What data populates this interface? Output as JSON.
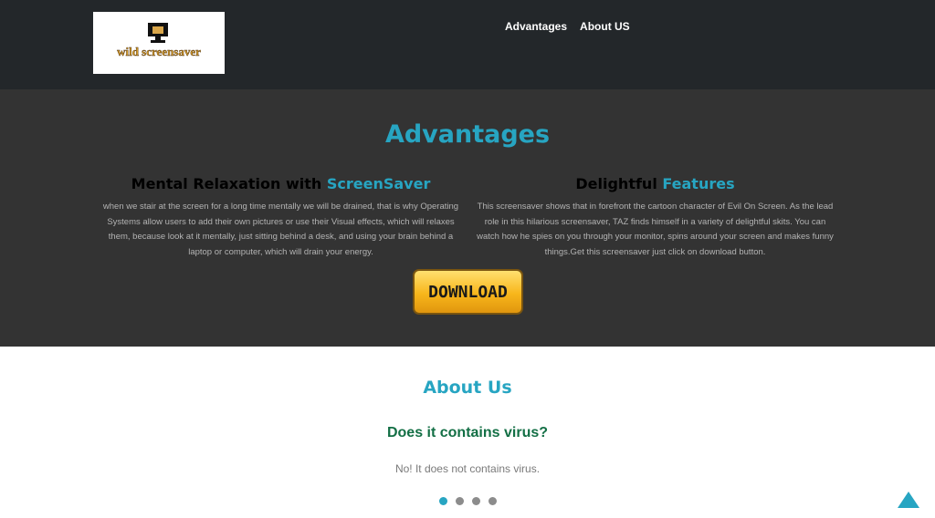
{
  "header": {
    "logo_text": "wild screensaver",
    "nav": [
      {
        "label": "Advantages"
      },
      {
        "label": "About US"
      }
    ]
  },
  "advantages": {
    "title": "Advantages",
    "left": {
      "heading_plain": "Mental Relaxation with ",
      "heading_accent": "ScreenSaver",
      "body": "when we stair at the screen for a long time mentally we will be drained, that is why Operating Systems allow users to add their own pictures or use their Visual effects, which will relaxes them, because look at it mentally, just sitting behind a desk, and using your brain behind a laptop or computer, which will drain your energy."
    },
    "right": {
      "heading_plain": "Delightful ",
      "heading_accent": "Features",
      "body": "This screensaver shows that in forefront the cartoon character of Evil On Screen. As the lead role in this hilarious screensaver, TAZ finds himself in a variety of delightful skits. You can watch how he spies on you through your monitor, spins around your screen and makes funny things.Get this screensaver just click on download button."
    },
    "download_label": "DOWNLOAD"
  },
  "about": {
    "title": "About Us",
    "question": "Does it contains virus?",
    "answer": "No! It does not contains virus.",
    "carousel_active_index": 0,
    "carousel_count": 4
  },
  "colors": {
    "accent": "#27a5c2",
    "header_bg": "#23272a",
    "section_bg": "#333333",
    "faq_green": "#136f45"
  },
  "icons": {
    "logo": "monitor-icon",
    "back_to_top": "triangle-up-icon"
  }
}
